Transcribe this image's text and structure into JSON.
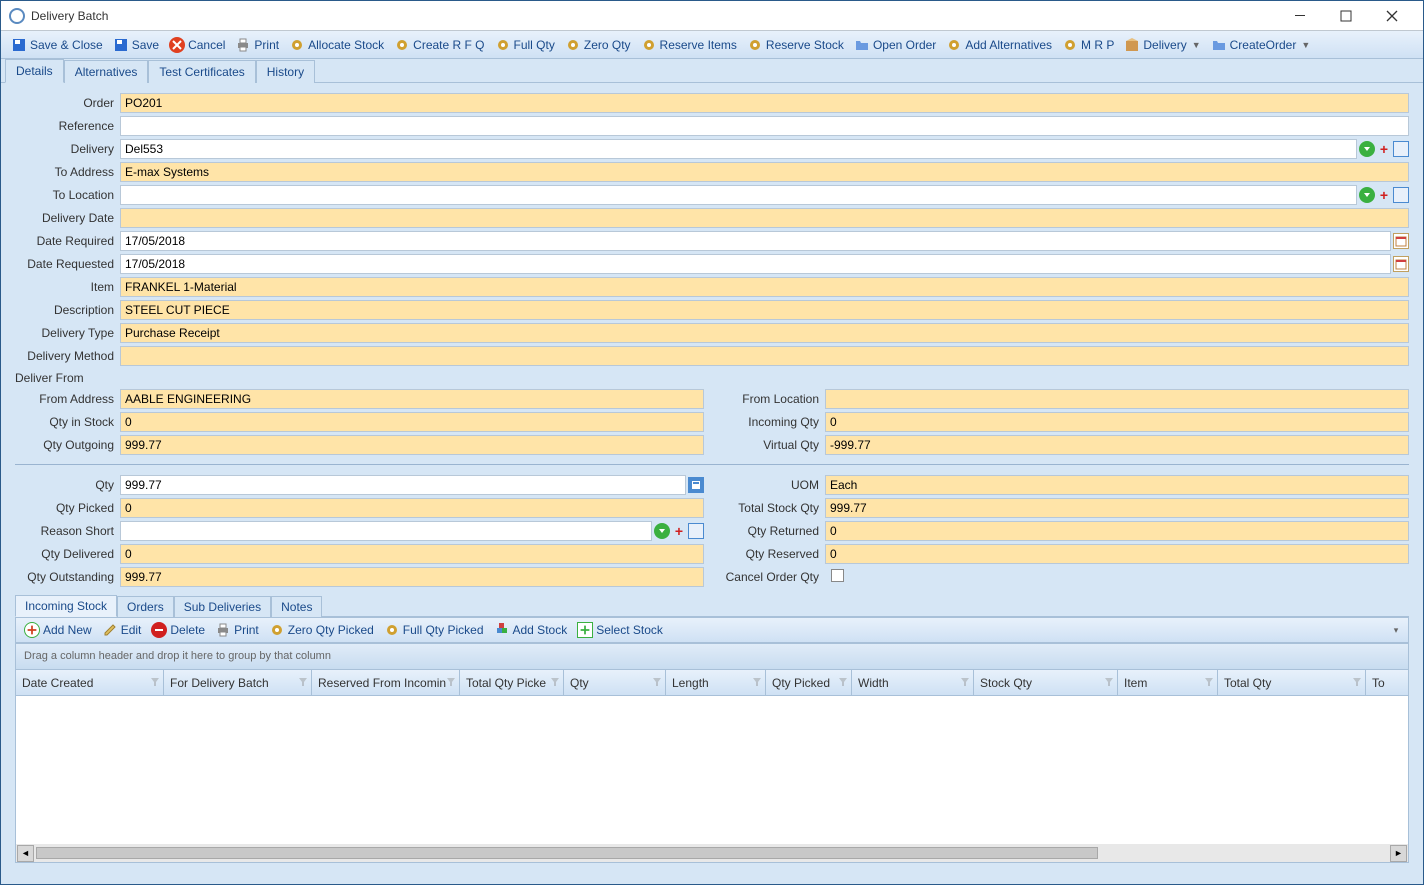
{
  "window": {
    "title": "Delivery Batch"
  },
  "toolbar": {
    "save_close": "Save & Close",
    "save": "Save",
    "cancel": "Cancel",
    "print": "Print",
    "allocate_stock": "Allocate Stock",
    "create_rfq": "Create R F Q",
    "full_qty": "Full Qty",
    "zero_qty": "Zero Qty",
    "reserve_items": "Reserve Items",
    "reserve_stock": "Reserve Stock",
    "open_order": "Open Order",
    "add_alternatives": "Add Alternatives",
    "mrp": "M R P",
    "delivery": "Delivery",
    "create_order": "CreateOrder"
  },
  "tabs": {
    "details": "Details",
    "alternatives": "Alternatives",
    "test_certificates": "Test Certificates",
    "history": "History"
  },
  "labels": {
    "order": "Order",
    "reference": "Reference",
    "delivery": "Delivery",
    "to_address": "To Address",
    "to_location": "To Location",
    "delivery_date": "Delivery Date",
    "date_required": "Date Required",
    "date_requested": "Date Requested",
    "item": "Item",
    "description": "Description",
    "delivery_type": "Delivery Type",
    "delivery_method": "Delivery Method",
    "deliver_from": "Deliver From",
    "from_address": "From Address",
    "from_location": "From Location",
    "qty_in_stock": "Qty in Stock",
    "incoming_qty": "Incoming Qty",
    "qty_outgoing": "Qty Outgoing",
    "virtual_qty": "Virtual Qty",
    "qty": "Qty",
    "uom": "UOM",
    "qty_picked": "Qty Picked",
    "total_stock_qty": "Total Stock Qty",
    "reason_short": "Reason Short",
    "qty_returned": "Qty Returned",
    "qty_delivered": "Qty Delivered",
    "qty_reserved": "Qty Reserved",
    "qty_outstanding": "Qty Outstanding",
    "cancel_order_qty": "Cancel Order Qty"
  },
  "fields": {
    "order": "PO201",
    "reference": "",
    "delivery": "Del553",
    "to_address": "E-max Systems",
    "to_location": "",
    "delivery_date": "",
    "date_required": "17/05/2018",
    "date_requested": "17/05/2018",
    "item": "FRANKEL 1-Material",
    "description": "STEEL CUT PIECE",
    "delivery_type": "Purchase Receipt",
    "delivery_method": "",
    "from_address": "AABLE ENGINEERING",
    "from_location": "",
    "qty_in_stock": "0",
    "incoming_qty": "0",
    "qty_outgoing": "999.77",
    "virtual_qty": "-999.77",
    "qty": "999.77",
    "uom": "Each",
    "qty_picked": "0",
    "total_stock_qty": "999.77",
    "reason_short": "",
    "qty_returned": "0",
    "qty_delivered": "0",
    "qty_reserved": "0",
    "qty_outstanding": "999.77"
  },
  "subtabs": {
    "incoming_stock": "Incoming Stock",
    "orders": "Orders",
    "sub_deliveries": "Sub Deliveries",
    "notes": "Notes"
  },
  "subtoolbar": {
    "add_new": "Add New",
    "edit": "Edit",
    "delete": "Delete",
    "print": "Print",
    "zero_qty_picked": "Zero Qty Picked",
    "full_qty_picked": "Full Qty Picked",
    "add_stock": "Add Stock",
    "select_stock": "Select Stock"
  },
  "grid": {
    "group_hint": "Drag a column header and drop it here to group by that column",
    "columns": {
      "date_created": "Date Created",
      "for_delivery_batch": "For Delivery Batch",
      "reserved_from": "Reserved From Incomin",
      "total_qty_picked": "Total Qty Picke",
      "qty": "Qty",
      "length": "Length",
      "qty_picked": "Qty Picked",
      "width": "Width",
      "stock_qty": "Stock Qty",
      "item": "Item",
      "total_qty": "Total Qty",
      "to": "To"
    }
  }
}
